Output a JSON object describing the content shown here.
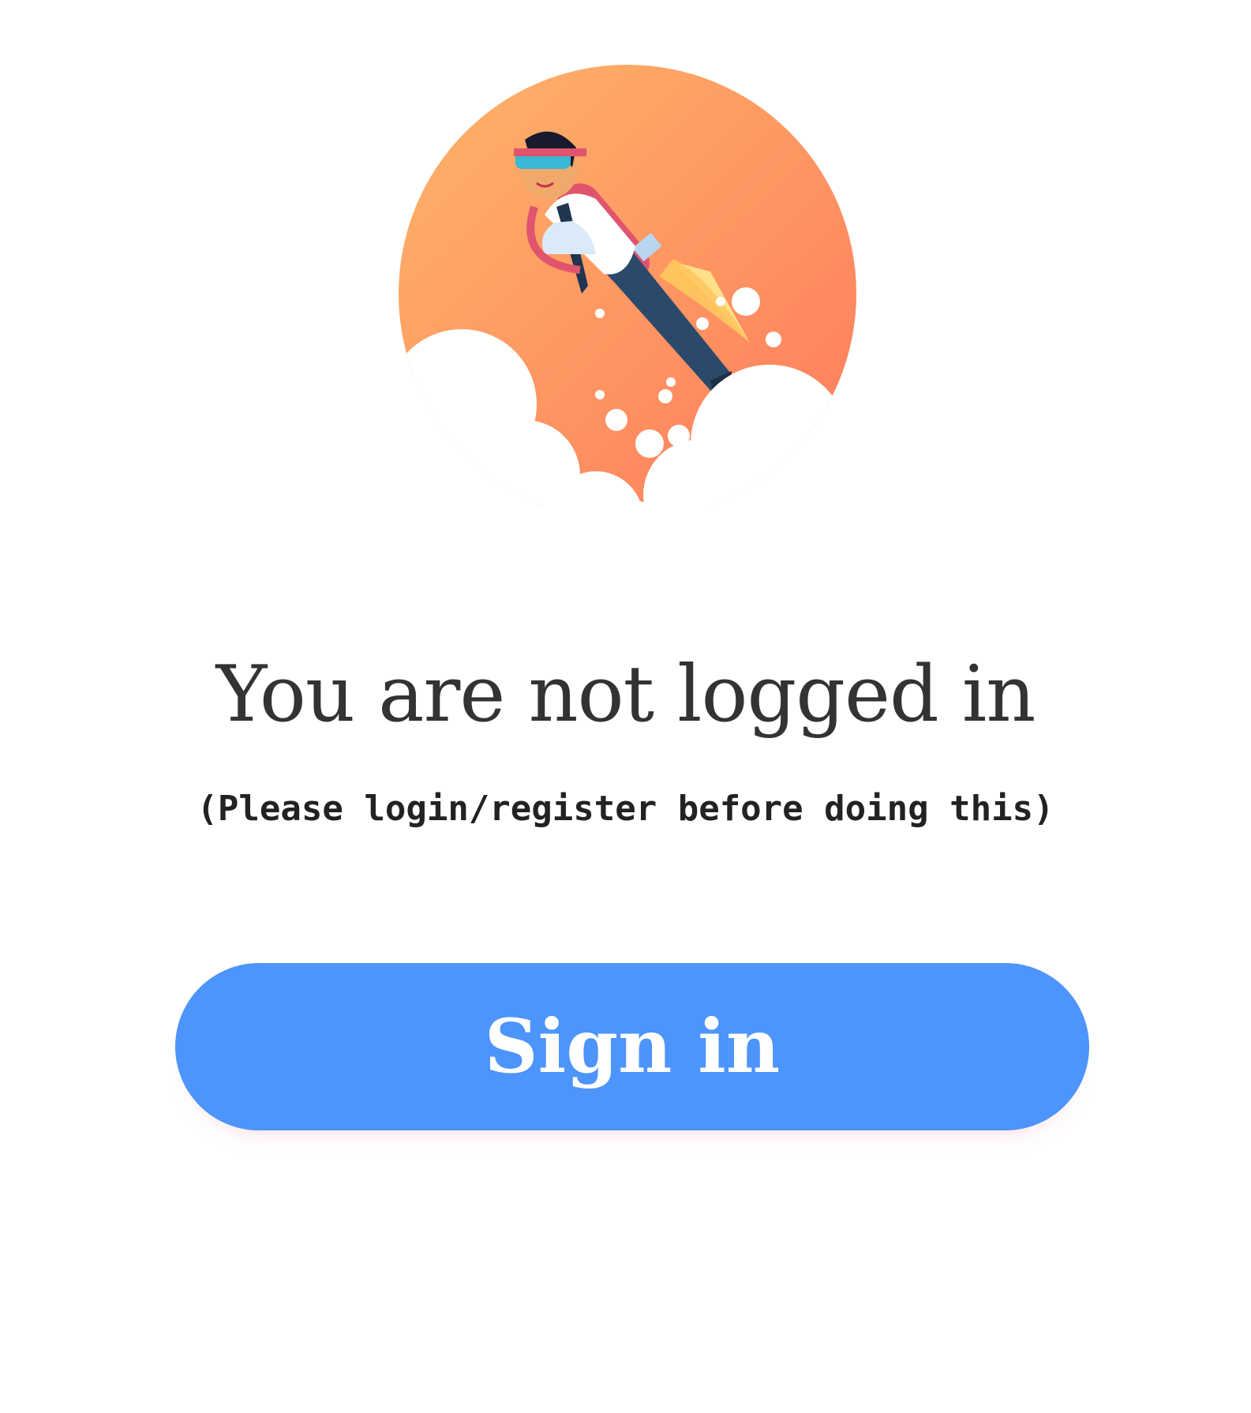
{
  "illustration": {
    "name": "rocket-man-illustration",
    "colors": {
      "circle_start": "#fdb168",
      "circle_end": "#ff7f5c",
      "cloud": "#ffffff",
      "jetpack": "#e0546e",
      "pants": "#2b4a6b",
      "flame": "#ffd27a"
    }
  },
  "message": {
    "title": "You are not logged in",
    "subtitle": "(Please login/register before doing this)"
  },
  "actions": {
    "sign_in_label": "Sign in",
    "sign_in_color": "#4d94fb"
  }
}
